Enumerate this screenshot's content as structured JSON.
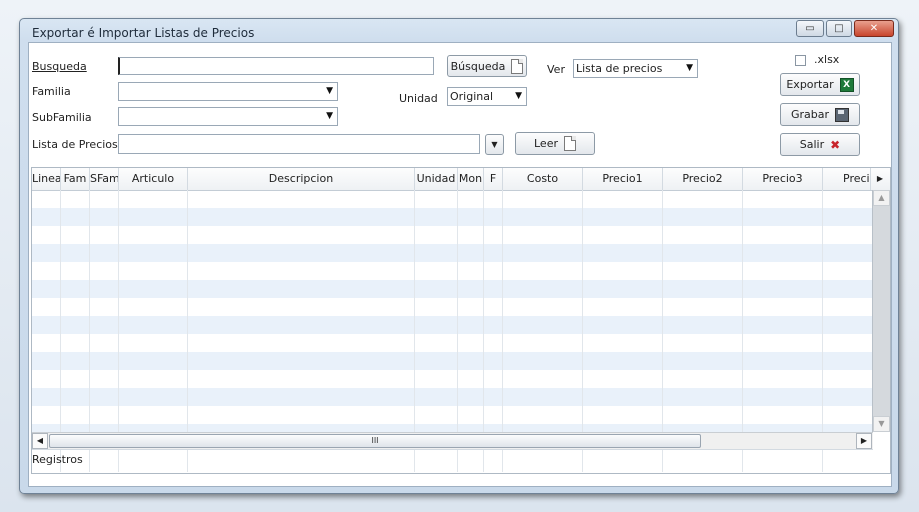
{
  "window": {
    "title": "Exportar é Importar Listas de Precios",
    "minimize": "▭",
    "maximize": "□",
    "close": "✕"
  },
  "form": {
    "busqueda_label": "Busqueda",
    "busqueda_value": "",
    "familia_label": "Familia",
    "subfamilia_label": "SubFamilia",
    "lista_label": "Lista de Precios",
    "busqueda_button": "Búsqueda",
    "ver_label": "Ver",
    "ver_value": "Lista de precios",
    "unidad_label": "Unidad",
    "unidad_value": "Original",
    "leer_button": "Leer",
    "xlsx_label": ".xlsx",
    "xlsx_checked": false,
    "exportar_button": "Exportar",
    "grabar_button": "Grabar",
    "salir_button": "Salir"
  },
  "grid": {
    "columns": [
      "Linea",
      "Fam",
      "SFam",
      "Articulo",
      "Descripcion",
      "Unidad",
      "Mon",
      "F",
      "Costo",
      "Precio1",
      "Precio2",
      "Precio3",
      "Precio"
    ],
    "scroll_thumb_label": "III",
    "footer_label": "Registros"
  },
  "colors": {
    "row_alt": "#e9f1fa",
    "window_frame": "#cfdeee",
    "close_red": "#c8452c"
  },
  "icons": {
    "busqueda": "document-icon",
    "leer": "document-icon",
    "exportar": "excel-icon",
    "grabar": "save-disk-icon",
    "salir": "close-x-icon"
  }
}
